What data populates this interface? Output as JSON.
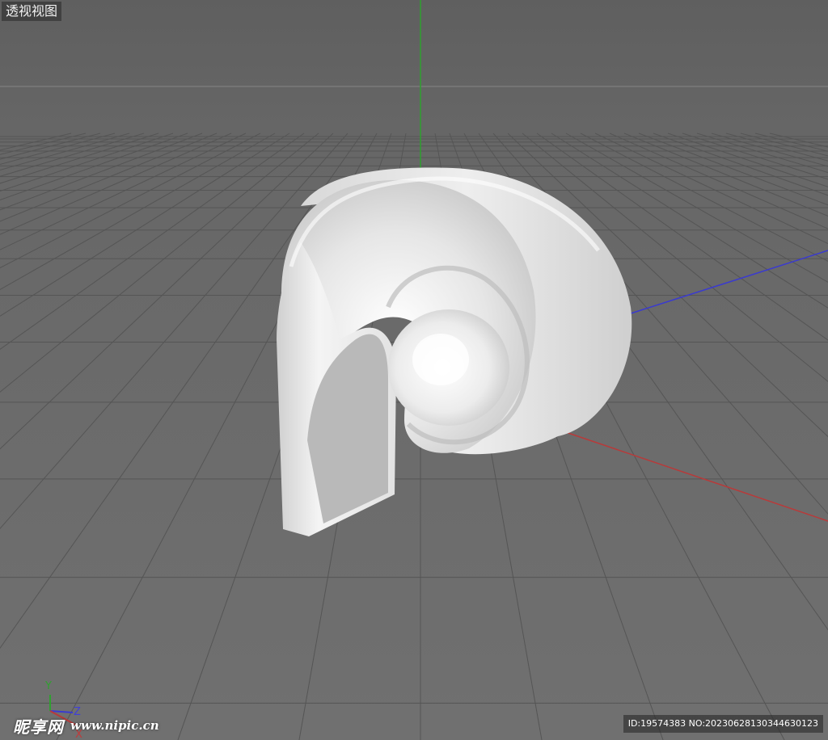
{
  "viewport": {
    "label": "透视视图"
  },
  "gizmo": {
    "y_label": "Y",
    "z_label": "Z",
    "x_label": "X"
  },
  "watermark": {
    "brand": "昵享网",
    "url": "www.nipic.cn"
  },
  "image_id": "ID:19574383 NO:20230628130344630123",
  "colors": {
    "background": "#6a6a6a",
    "grid": "#555555",
    "axis_x": "#b83a3a",
    "axis_y": "#2fa02f",
    "axis_z": "#3a3ad0",
    "object": "#e8e8e8"
  }
}
